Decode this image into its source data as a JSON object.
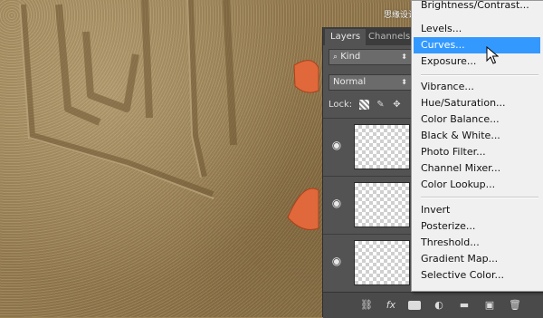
{
  "watermark": "思缘设计论坛 www.missyuan.com",
  "panel": {
    "tabs": [
      "Layers",
      "Channels"
    ],
    "kind_label": "Kind",
    "blend_mode": "Normal",
    "lock_label": "Lock:",
    "layers": [
      {
        "visible": true,
        "thumbnail": "transparent"
      },
      {
        "visible": true,
        "thumbnail": "transparent"
      },
      {
        "visible": true,
        "thumbnail": "transparent"
      }
    ],
    "footer_icons": [
      "link-icon",
      "fx-icon",
      "mask-icon",
      "adjustment-icon",
      "folder-icon",
      "new-layer-icon",
      "trash-icon"
    ],
    "footer_fx": "fx"
  },
  "menu": {
    "groups": [
      [
        "Brightness/Contrast...",
        "Levels...",
        "Curves...",
        "Exposure..."
      ],
      [
        "Vibrance...",
        "Hue/Saturation...",
        "Color Balance...",
        "Black & White...",
        "Photo Filter...",
        "Channel Mixer...",
        "Color Lookup..."
      ],
      [
        "Invert",
        "Posterize...",
        "Threshold...",
        "Gradient Map...",
        "Selective Color..."
      ]
    ],
    "selected": "Curves...",
    "selected_color": "#3399ff"
  },
  "colors": {
    "panel_bg": "#535353",
    "menu_bg": "#f0f0f0",
    "starfish": "#e0683a"
  }
}
